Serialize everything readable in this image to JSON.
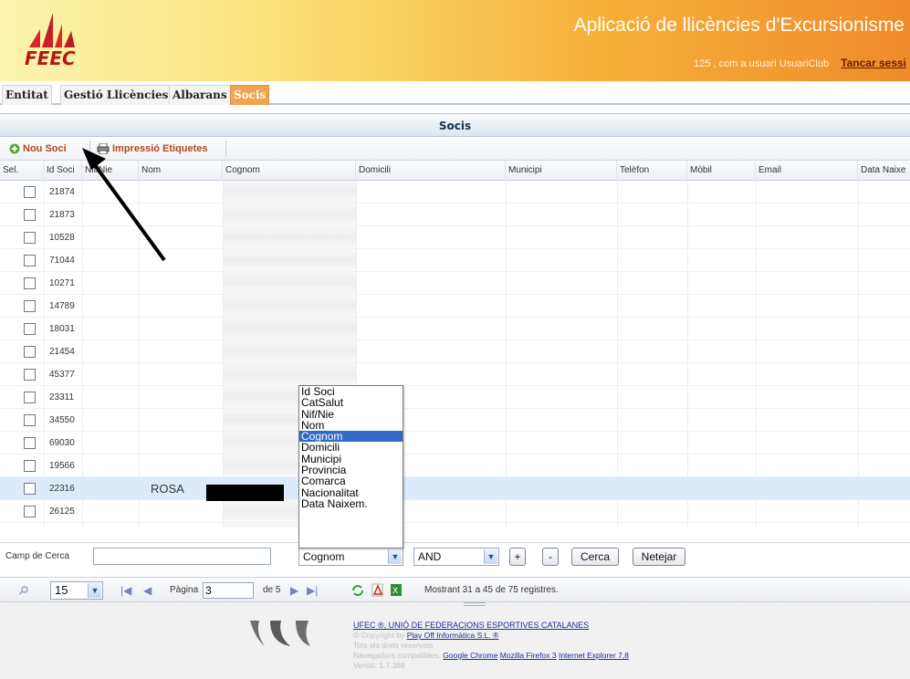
{
  "header": {
    "logo_text": "FEEC",
    "app_title": "Aplicació de llicències d'Excursionisme",
    "user_line": "125 , com a usuari  UsuariClub",
    "logout_label": "Tancar sessi"
  },
  "tabs": [
    {
      "label": "Entitat"
    },
    {
      "label": "Gestió Llicències"
    },
    {
      "label": "Albarans"
    },
    {
      "label": "Socis"
    }
  ],
  "panel": {
    "title": "Socis"
  },
  "toolbar": {
    "new_label": "Nou Soci",
    "print_label": "Impressió Etiquetes"
  },
  "grid": {
    "columns": [
      "Sel.",
      "Id Soci",
      "Nif/Nie",
      "Nom",
      "Cognom",
      "Domicili",
      "Municipi",
      "Telèfon",
      "Mòbil",
      "Email",
      "Data Naixe"
    ],
    "rows": [
      {
        "id": "21874",
        "nom": ""
      },
      {
        "id": "21873",
        "nom": ""
      },
      {
        "id": "10528",
        "nom": ""
      },
      {
        "id": "71044",
        "nom": ""
      },
      {
        "id": "10271",
        "nom": ""
      },
      {
        "id": "14789",
        "nom": ""
      },
      {
        "id": "18031",
        "nom": ""
      },
      {
        "id": "21454",
        "nom": ""
      },
      {
        "id": "45377",
        "nom": ""
      },
      {
        "id": "23311",
        "nom": ""
      },
      {
        "id": "34550",
        "nom": ""
      },
      {
        "id": "69030",
        "nom": ""
      },
      {
        "id": "19566",
        "nom": ""
      },
      {
        "id": "22316",
        "nom": "ROSA"
      },
      {
        "id": "26125",
        "nom": ""
      }
    ],
    "selected_row_index": 13
  },
  "dropdown": {
    "options": [
      "Id Soci",
      "CatSalut",
      "Nif/Nie",
      "Nom",
      "Cognom",
      "Domicili",
      "Municipi",
      "Provincia",
      "Comarca",
      "Nacionalitat",
      "Data Naixem."
    ],
    "highlighted_index": 4
  },
  "search": {
    "label": "Camp de Cerca",
    "value": "",
    "field_selected": "Cognom",
    "operator_selected": "AND",
    "plus_label": "+",
    "minus_label": "-",
    "search_label": "Cerca",
    "clear_label": "Netejar"
  },
  "pager": {
    "page_size": "15",
    "page_label": "Pàgina",
    "page_value": "3",
    "of_label": "de 5",
    "status": "Mostrant 31 a 45 de 75 registres."
  },
  "footer": {
    "org_link": "UFEC ®, UNIÓ DE FEDERACIONS ESPORTIVES CATALANES",
    "copyright_prefix": "© Copyright by",
    "copyright_link": "Play Off Informàtica S.L. ®",
    "rights": "Tots els drets reservats",
    "browsers_prefix": "Navegadors compatibles:",
    "browser_chrome": "Google Chrome",
    "browser_firefox": "Mozilla Firefox 3",
    "browser_ie": "Internet Explorer 7,8",
    "version": "Versió: 1.7.388"
  },
  "colors": {
    "accent_tab": "#f3a34b",
    "brand_red": "#b01818",
    "highlight": "#3169c6",
    "selected_row": "#dceafa"
  }
}
